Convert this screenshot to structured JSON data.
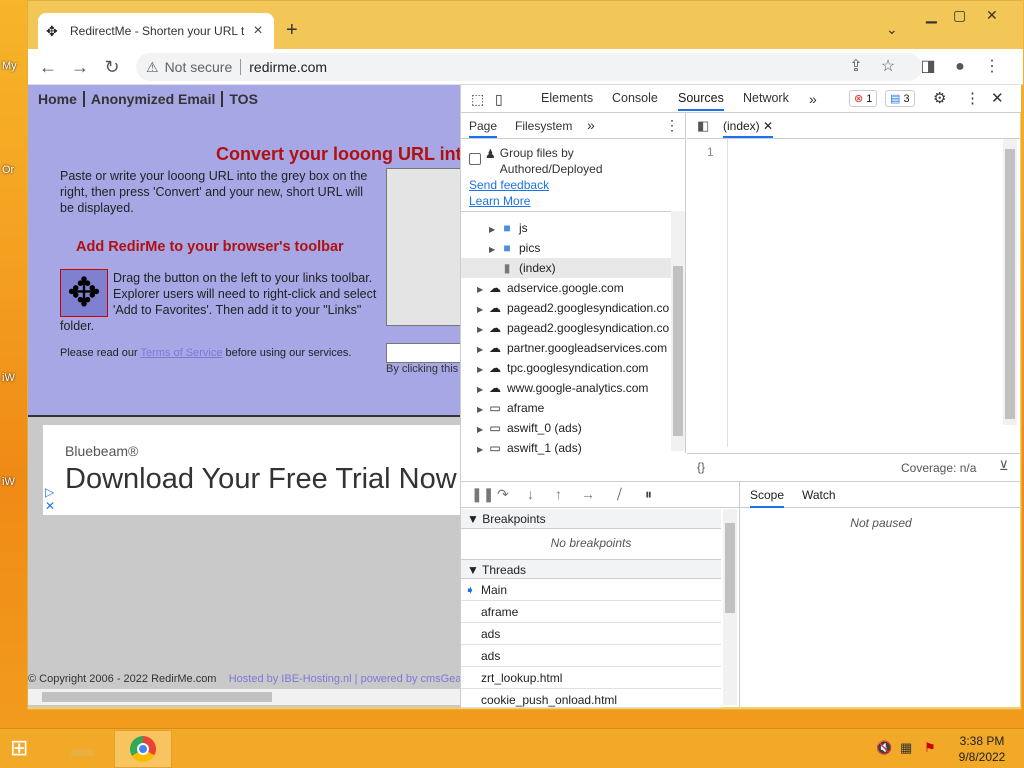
{
  "desktop": {
    "icons": [
      "My",
      "Or",
      "iW",
      "iW"
    ]
  },
  "browser": {
    "tab_title": "RedirectMe - Shorten your URL t",
    "new_tab": "+",
    "not_secure": "Not secure",
    "url": "redirme.com"
  },
  "site": {
    "nav": [
      "Home",
      "Anonymized Email",
      "TOS"
    ],
    "title": "Convert your looong URL int",
    "intro": "Paste or write your looong URL into the grey box on the right, then press 'Convert' and your new, short URL will be displayed.",
    "subtitle": "Add RedirMe to your browser's toolbar",
    "drag_text": "Drag the button on the left to your links toolbar. Explorer users will need to right-click and select 'Add to Favorites'. Then add it to your \"Links\" folder.",
    "tos_pre": "Please read our ",
    "tos_link": "Terms of Service",
    "tos_post": " before using our services.",
    "by_clicking": "By clicking this",
    "ad_brand": "Bluebeam®",
    "ad_headline": "Download Your Free Trial Now",
    "copyright": "© Copyright 2006 - 2022 RedirMe.com",
    "hosted": "Hosted by IBE-Hosting.nl | powered by cmsGear"
  },
  "devtools": {
    "tabs": [
      "Elements",
      "Console",
      "Sources",
      "Network"
    ],
    "more": "»",
    "errors": "1",
    "messages": "3",
    "nav_tabs": [
      "Page",
      "Filesystem"
    ],
    "group_files": "Group files by Authored/Deployed",
    "send_feedback": "Send feedback",
    "learn_more": "Learn More",
    "tree": [
      "js",
      "pics",
      "(index)",
      "adservice.google.com",
      "pagead2.googlesyndication.co",
      "pagead2.googlesyndication.co",
      "partner.googleadservices.com",
      "tpc.googlesyndication.com",
      "www.google-analytics.com",
      "aframe",
      "aswift_0 (ads)",
      "aswift_1 (ads)"
    ],
    "editor_tab": "(index)",
    "line_number": "1",
    "pretty_print": "{}",
    "coverage": "Coverage: n/a",
    "breakpoints_title": "Breakpoints",
    "no_breakpoints": "No breakpoints",
    "threads_title": "Threads",
    "threads": [
      "Main",
      "aframe",
      "ads",
      "ads",
      "zrt_lookup.html",
      "cookie_push_onload.html"
    ],
    "scope_tab": "Scope",
    "watch_tab": "Watch",
    "not_paused": "Not paused"
  },
  "taskbar": {
    "time": "3:38 PM",
    "date": "9/8/2022"
  }
}
